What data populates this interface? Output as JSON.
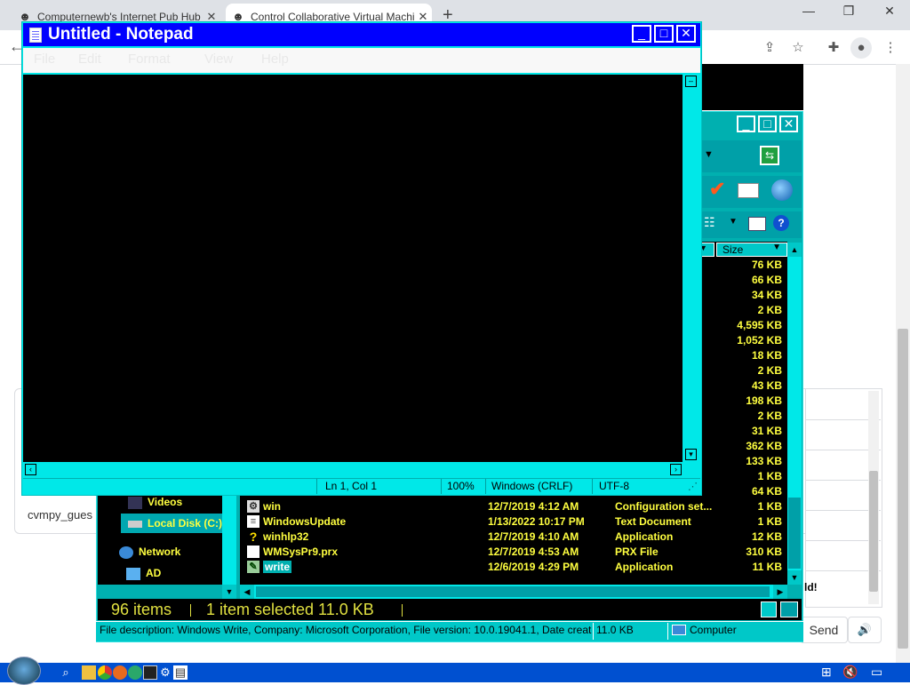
{
  "browser": {
    "tabs": [
      {
        "label": "Computernewb's Internet Pub Hub",
        "active": false
      },
      {
        "label": "Control Collaborative Virtual Machi",
        "active": true
      }
    ],
    "new_tab": "+",
    "tab_close": "✕",
    "window_controls": [
      "—",
      "❐",
      "✕"
    ]
  },
  "page": {
    "guest_name": "cvmpy_gues",
    "right_panel_text": "ld!",
    "send_label": "Send",
    "speaker_icon": "🔊"
  },
  "notepad": {
    "title": "Untitled - Notepad",
    "menu": [
      "File",
      "Edit",
      "Format",
      "View",
      "Help"
    ],
    "text": "",
    "status": {
      "position": "Ln 1, Col 1",
      "zoom": "100%",
      "line_ending": "Windows (CRLF)",
      "encoding": "UTF-8"
    }
  },
  "explorer": {
    "column_size_label": "Size",
    "sizes_above": [
      "76 KB",
      "66 KB",
      "34 KB",
      "2 KB",
      "4,595 KB",
      "1,052 KB",
      "18 KB",
      "2 KB",
      "43 KB",
      "198 KB",
      "2 KB",
      "31 KB",
      "362 KB",
      "133 KB",
      "1 KB",
      "64 KB"
    ],
    "files": [
      {
        "name": "win",
        "date": "12/7/2019 4:12 AM",
        "type": "Configuration set...",
        "size": "1 KB",
        "icon": "settings-file-icon"
      },
      {
        "name": "WindowsUpdate",
        "date": "1/13/2022 10:17 PM",
        "type": "Text Document",
        "size": "1 KB",
        "icon": "text-file-icon"
      },
      {
        "name": "winhlp32",
        "date": "12/7/2019 4:10 AM",
        "type": "Application",
        "size": "12 KB",
        "icon": "help-icon"
      },
      {
        "name": "WMSysPr9.prx",
        "date": "12/7/2019 4:53 AM",
        "type": "PRX File",
        "size": "310 KB",
        "icon": "generic-file-icon"
      },
      {
        "name": "write",
        "date": "12/6/2019 4:29 PM",
        "type": "Application",
        "size": "11 KB",
        "icon": "write-app-icon",
        "selected": true
      }
    ],
    "nav": [
      {
        "label": "Videos",
        "icon": "videos-folder-icon"
      },
      {
        "label": "Local Disk (C:)",
        "icon": "drive-icon",
        "selected": true
      },
      {
        "label": "Network",
        "icon": "network-icon"
      },
      {
        "label": "AD",
        "icon": "computer-icon"
      }
    ],
    "status": {
      "items": "96 items",
      "selected": "1 item selected  11.0 KB"
    },
    "details": {
      "description": "File description: Windows Write, Company: Microsoft Corporation, File version: 10.0.19041.1, Date created",
      "size": "11.0 KB",
      "location": "Computer"
    }
  },
  "taskbar": {
    "apps": [
      "search-icon",
      "file-explorer-icon",
      "chrome-icon",
      "firefox-icon",
      "edge-icon",
      "terminal-icon",
      "settings-icon",
      "notepad-icon"
    ],
    "tray": [
      "network-icon",
      "volume-muted-icon",
      "notification-icon"
    ]
  },
  "colors": {
    "titlebar": "#0000ff",
    "window_accent": "#00e8e8",
    "file_text": "#ffff40",
    "taskbar": "#0050d0"
  }
}
